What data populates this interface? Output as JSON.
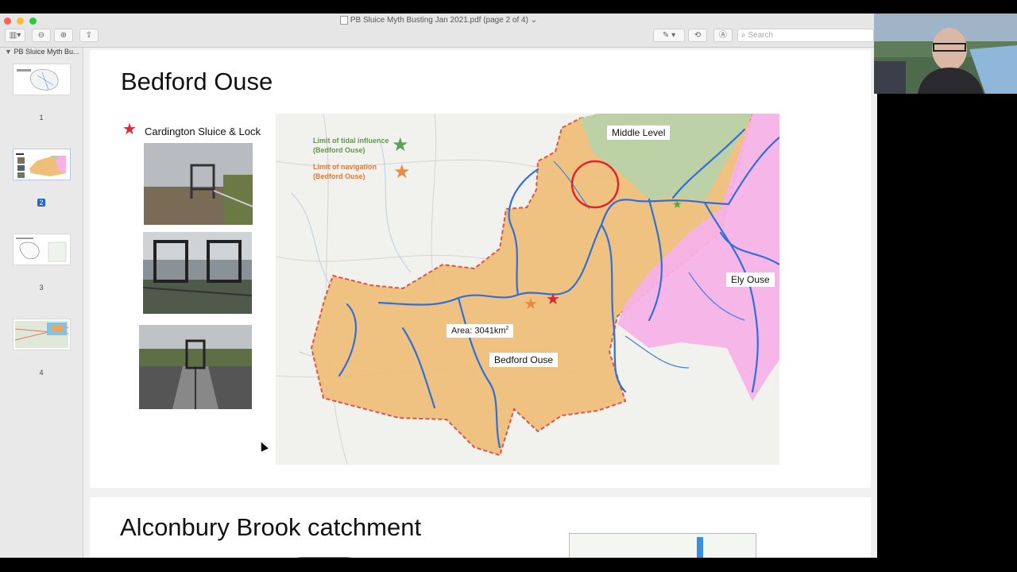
{
  "window": {
    "title": "PB Sluice Myth Busting Jan 2021.pdf (page 2 of 4)",
    "search_placeholder": "Search",
    "colors": {
      "close": "#fe5f57",
      "minimize": "#febc2e",
      "zoom": "#28c840"
    }
  },
  "toolbar": {
    "icons": [
      "sidebar-toggle-icon",
      "zoom-out-icon",
      "zoom-in-icon",
      "share-icon",
      "markup-pen-icon",
      "chevron-down-icon",
      "rotate-icon",
      "annotate-icon",
      "search-icon"
    ]
  },
  "sidebar": {
    "doc_name": "PB Sluice Myth Bu...",
    "thumbnails": [
      {
        "page": "1"
      },
      {
        "page": "2",
        "selected": true
      },
      {
        "page": "3"
      },
      {
        "page": "4"
      }
    ]
  },
  "slide": {
    "title": "Bedford Ouse",
    "legend": {
      "red_star_label": "Cardington Sluice & Lock",
      "tidal_label_1": "Limit of tidal influence",
      "tidal_label_2": "(Bedford Ouse)",
      "nav_label_1": "Limit of navigation",
      "nav_label_2": "(Bedford Ouse)"
    },
    "map": {
      "labels": {
        "middle_level": "Middle Level",
        "ely_ouse": "Ely Ouse",
        "bedford_ouse": "Bedford Ouse",
        "area": "Area: 3041km",
        "area_sup": "2"
      },
      "colors": {
        "bedford": "#efbf7a",
        "ely": "#f6b2e6",
        "middle": "#b8d2a6",
        "river": "#2f6fd8",
        "boundary": "#e0483a"
      }
    }
  },
  "next_slide": {
    "title": "Alconbury Brook catchment"
  }
}
